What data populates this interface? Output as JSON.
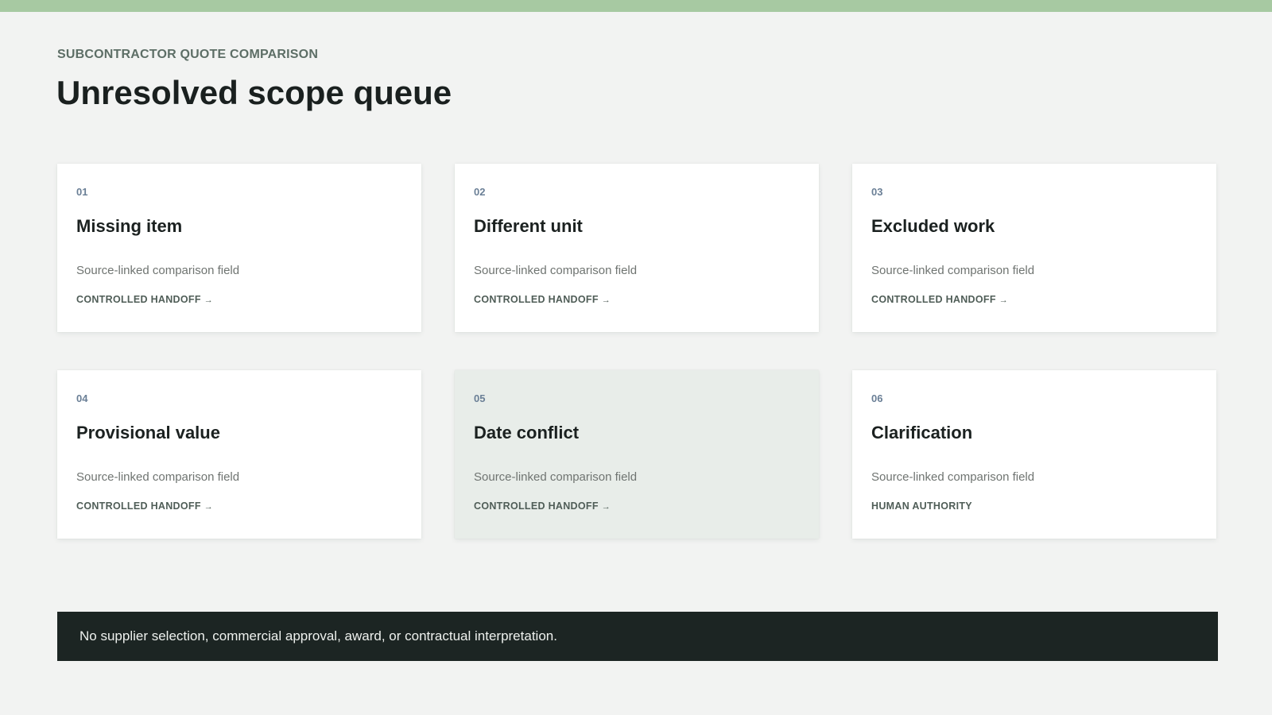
{
  "header": {
    "eyebrow": "SUBCONTRACTOR QUOTE COMPARISON",
    "title": "Unresolved scope queue"
  },
  "cards": [
    {
      "num": "01",
      "title": "Missing item",
      "desc": "Source-linked comparison field",
      "action": "CONTROLLED HANDOFF",
      "arrow": "→"
    },
    {
      "num": "02",
      "title": "Different unit",
      "desc": "Source-linked comparison field",
      "action": "CONTROLLED HANDOFF",
      "arrow": "→"
    },
    {
      "num": "03",
      "title": "Excluded work",
      "desc": "Source-linked comparison field",
      "action": "CONTROLLED HANDOFF",
      "arrow": "→"
    },
    {
      "num": "04",
      "title": "Provisional value",
      "desc": "Source-linked comparison field",
      "action": "CONTROLLED HANDOFF",
      "arrow": "→"
    },
    {
      "num": "05",
      "title": "Date conflict",
      "desc": "Source-linked comparison field",
      "action": "CONTROLLED HANDOFF",
      "arrow": "→"
    },
    {
      "num": "06",
      "title": "Clarification",
      "desc": "Source-linked comparison field",
      "action": "HUMAN AUTHORITY",
      "arrow": ""
    }
  ],
  "footer": {
    "notice": "No supplier selection, commercial approval, award, or contractual interpretation."
  },
  "colors": {
    "accent_bar": "#a7c9a2",
    "background": "#f2f3f2",
    "card": "#ffffff",
    "card_highlighted": "#e8ede9",
    "banner": "#1c2523"
  }
}
